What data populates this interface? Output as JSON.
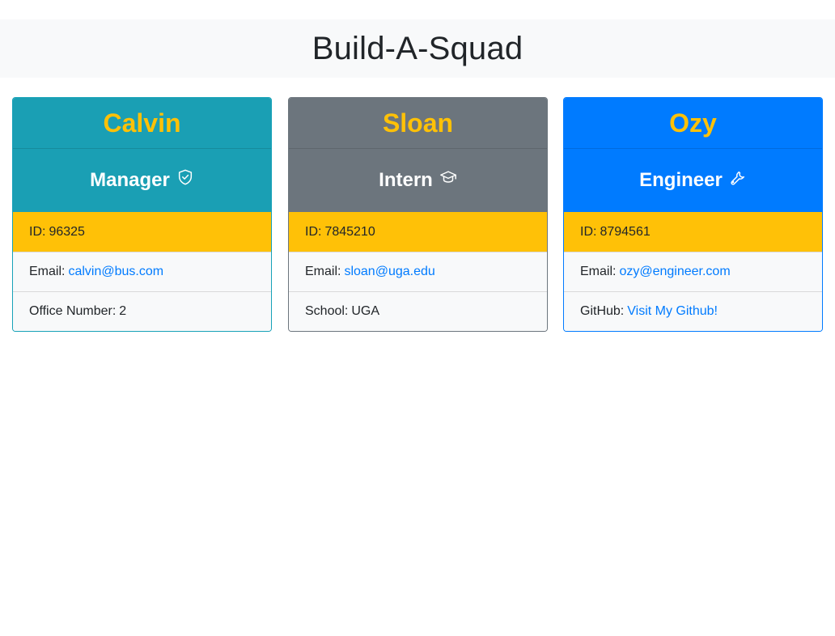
{
  "page": {
    "title": "Build-A-Squad"
  },
  "cards": [
    {
      "name": "Calvin",
      "role": "Manager",
      "role_icon": "shield-check-icon",
      "id_label": "ID:",
      "id": "96325",
      "email_label": "Email:",
      "email": "calvin@bus.com",
      "extra_label": "Office Number:",
      "extra_value": "2",
      "header_color": "#1a9fb4"
    },
    {
      "name": "Sloan",
      "role": "Intern",
      "role_icon": "graduation-cap-icon",
      "id_label": "ID:",
      "id": "7845210",
      "email_label": "Email:",
      "email": "sloan@uga.edu",
      "extra_label": "School:",
      "extra_value": "UGA",
      "header_color": "#6c757d"
    },
    {
      "name": "Ozy",
      "role": "Engineer",
      "role_icon": "wrench-icon",
      "id_label": "ID:",
      "id": "8794561",
      "email_label": "Email:",
      "email": "ozy@engineer.com",
      "extra_label": "GitHub:",
      "extra_value": "Visit My Github!",
      "header_color": "#007bff"
    }
  ],
  "colors": {
    "accent_name": "#ffc107",
    "link": "#007bff",
    "id_row": "#ffc107"
  }
}
